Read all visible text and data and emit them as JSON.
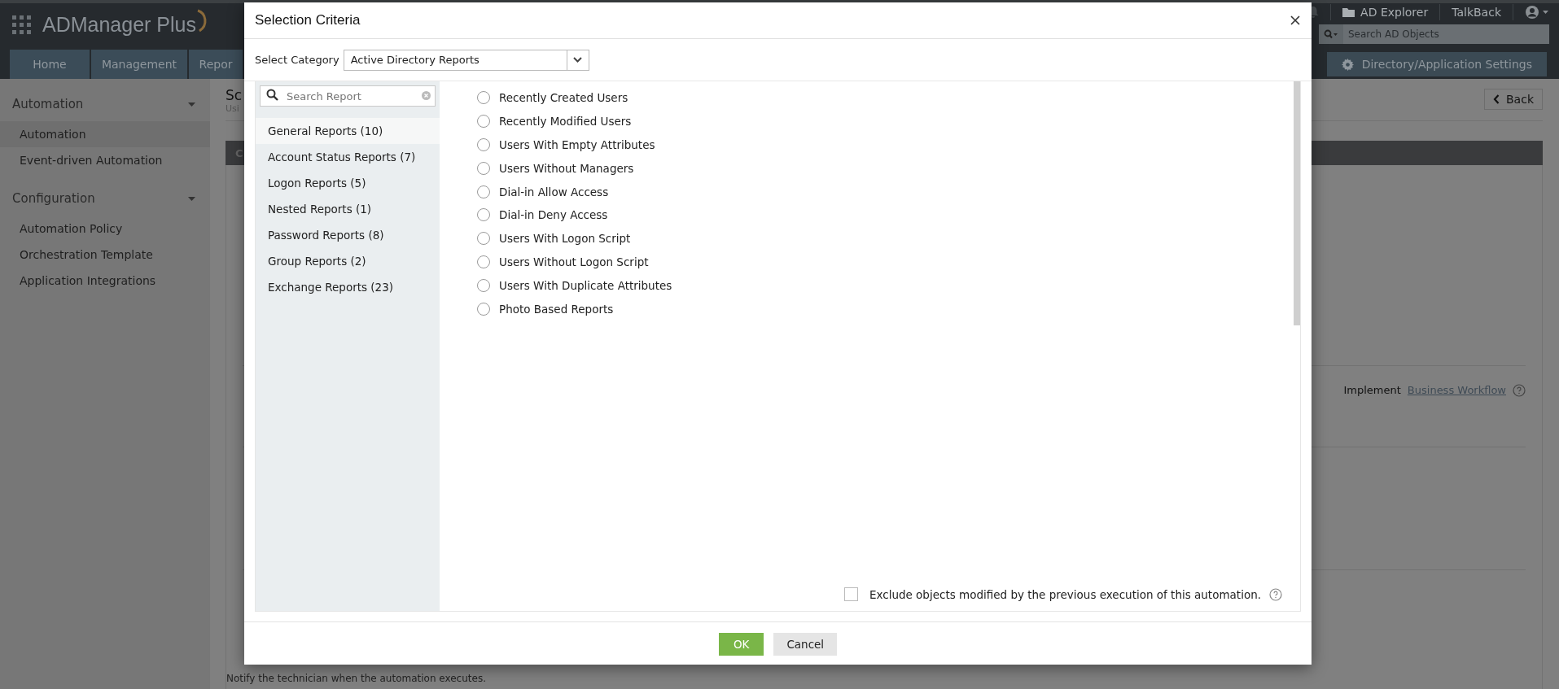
{
  "header": {
    "logo": "ADManager Plus",
    "links": [
      "AD Explorer",
      "TalkBack"
    ],
    "search": {
      "placeholder": "Search AD Objects"
    }
  },
  "nav": {
    "tabs": [
      {
        "label": "Home",
        "selected": false
      },
      {
        "label": "Management",
        "selected": false
      },
      {
        "label": "Repor",
        "selected": false
      }
    ],
    "settings_button": "Directory/Application Settings"
  },
  "sidebar": {
    "sections": [
      {
        "title": "Automation",
        "expanded": true,
        "items": [
          {
            "label": "Automation",
            "selected": true
          },
          {
            "label": "Event-driven Automation",
            "selected": false
          }
        ]
      },
      {
        "title": "Configuration",
        "expanded": true,
        "items": [
          {
            "label": "Automation Policy",
            "selected": false
          },
          {
            "label": "Orchestration Template",
            "selected": false
          },
          {
            "label": "Application Integrations",
            "selected": false
          }
        ]
      }
    ]
  },
  "page": {
    "title": "Sc",
    "subtitle": "Usi",
    "section_header": "C",
    "back_button": "Back",
    "workflow": {
      "label": "Implement",
      "link": "Business Workflow"
    },
    "notify_text": "Notify the technician when the automation executes."
  },
  "dialog": {
    "title": "Selection Criteria",
    "category_label": "Select Category",
    "category_value": "Active Directory Reports",
    "search": {
      "placeholder": "Search Report"
    },
    "categories": [
      {
        "label": "General Reports (10)",
        "selected": true
      },
      {
        "label": "Account Status Reports (7)",
        "selected": false
      },
      {
        "label": "Logon Reports (5)",
        "selected": false
      },
      {
        "label": "Nested Reports (1)",
        "selected": false
      },
      {
        "label": "Password Reports (8)",
        "selected": false
      },
      {
        "label": "Group Reports (2)",
        "selected": false
      },
      {
        "label": "Exchange Reports (23)",
        "selected": false
      }
    ],
    "reports": [
      {
        "label": "Recently Created Users",
        "selected": false
      },
      {
        "label": "Recently Modified Users",
        "selected": false
      },
      {
        "label": "Users With Empty Attributes",
        "selected": false
      },
      {
        "label": "Users Without Managers",
        "selected": false
      },
      {
        "label": "Dial-in Allow Access",
        "selected": false
      },
      {
        "label": "Dial-in Deny Access",
        "selected": false
      },
      {
        "label": "Users With Logon Script",
        "selected": false
      },
      {
        "label": "Users Without Logon Script",
        "selected": false
      },
      {
        "label": "Users With Duplicate Attributes",
        "selected": false
      },
      {
        "label": "Photo Based Reports",
        "selected": false
      }
    ],
    "exclude": {
      "checked": false,
      "label": "Exclude objects modified by the previous execution of this automation."
    },
    "buttons": [
      "OK",
      "Cancel"
    ]
  }
}
